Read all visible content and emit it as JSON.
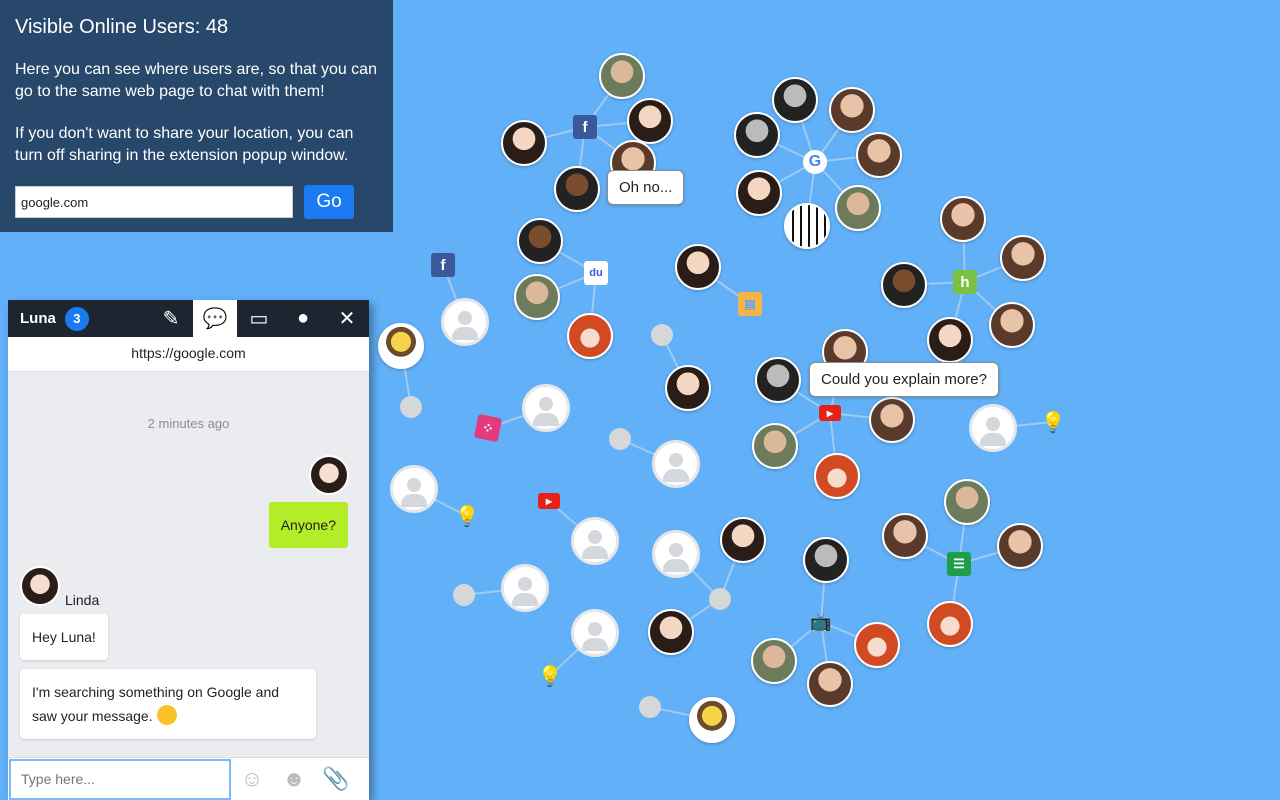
{
  "info": {
    "title": "Visible Online Users: 48",
    "para1": "Here you can see where users are, so that you can go to the same web page to chat with them!",
    "para2": "If you don't want to share your location, you can turn off sharing in the extension popup window.",
    "search_value": "google.com",
    "go_label": "Go"
  },
  "chat": {
    "user_name": "Luna",
    "unread_count": "3",
    "tabs": [
      "edit-icon",
      "chat-bubbles-icon",
      "inbox-icon",
      "account-icon",
      "close-icon"
    ],
    "url": "https://google.com",
    "time": "2 minutes ago",
    "messages": {
      "self_1": "Anyone?",
      "other_name": "Linda",
      "other_1": "Hey Luna!",
      "other_2": "I'm searching something on Google and saw your message."
    },
    "composer_placeholder": "Type here...",
    "composer_icons": [
      "laugh-emoji-icon",
      "smile-emoji-icon",
      "paperclip-icon"
    ]
  },
  "bubbles": {
    "oh_no": "Oh no...",
    "explain": "Could you explain more?"
  },
  "site_labels": {
    "facebook": "f",
    "google": "G",
    "baidu": "du",
    "youtube": "▶",
    "houzz": "h"
  },
  "colors": {
    "background": "#62b0f8",
    "info_panel": "#27486b",
    "accent_blue": "#1a7bf2",
    "self_message": "#b2ed27"
  }
}
